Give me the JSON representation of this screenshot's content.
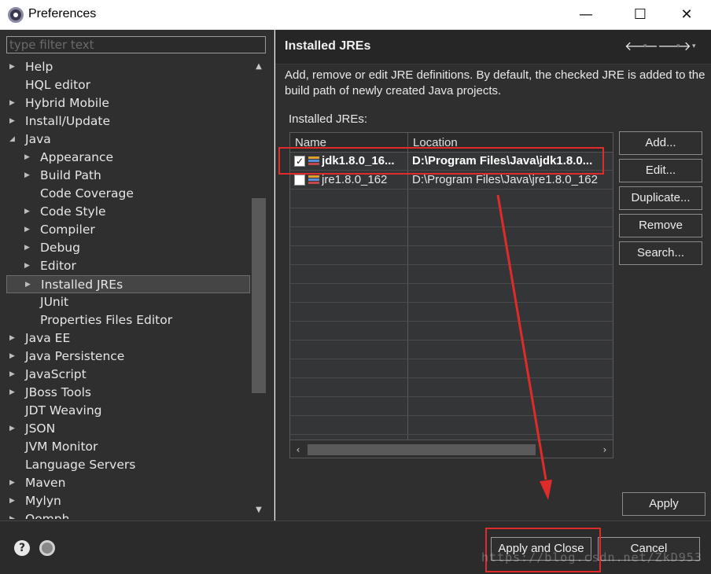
{
  "window": {
    "title": "Preferences",
    "minimize": "—",
    "maximize": "☐",
    "close": "✕"
  },
  "filter": {
    "placeholder": "type filter text"
  },
  "tree": [
    {
      "label": "Help",
      "level": 0,
      "expander": "▶"
    },
    {
      "label": "HQL editor",
      "level": 0,
      "expander": ""
    },
    {
      "label": "Hybrid Mobile",
      "level": 0,
      "expander": "▶"
    },
    {
      "label": "Install/Update",
      "level": 0,
      "expander": "▶"
    },
    {
      "label": "Java",
      "level": 0,
      "expander": "◢"
    },
    {
      "label": "Appearance",
      "level": 1,
      "expander": "▶"
    },
    {
      "label": "Build Path",
      "level": 1,
      "expander": "▶"
    },
    {
      "label": "Code Coverage",
      "level": 1,
      "expander": ""
    },
    {
      "label": "Code Style",
      "level": 1,
      "expander": "▶"
    },
    {
      "label": "Compiler",
      "level": 1,
      "expander": "▶"
    },
    {
      "label": "Debug",
      "level": 1,
      "expander": "▶"
    },
    {
      "label": "Editor",
      "level": 1,
      "expander": "▶"
    },
    {
      "label": "Installed JREs",
      "level": 1,
      "expander": "▶",
      "selected": true
    },
    {
      "label": "JUnit",
      "level": 1,
      "expander": ""
    },
    {
      "label": "Properties Files Editor",
      "level": 1,
      "expander": ""
    },
    {
      "label": "Java EE",
      "level": 0,
      "expander": "▶"
    },
    {
      "label": "Java Persistence",
      "level": 0,
      "expander": "▶"
    },
    {
      "label": "JavaScript",
      "level": 0,
      "expander": "▶"
    },
    {
      "label": "JBoss Tools",
      "level": 0,
      "expander": "▶"
    },
    {
      "label": "JDT Weaving",
      "level": 0,
      "expander": ""
    },
    {
      "label": "JSON",
      "level": 0,
      "expander": "▶"
    },
    {
      "label": "JVM Monitor",
      "level": 0,
      "expander": ""
    },
    {
      "label": "Language Servers",
      "level": 0,
      "expander": ""
    },
    {
      "label": "Maven",
      "level": 0,
      "expander": "▶"
    },
    {
      "label": "Mylyn",
      "level": 0,
      "expander": "▶"
    },
    {
      "label": "Oomph",
      "level": 0,
      "expander": "▶"
    }
  ],
  "page": {
    "title": "Installed JREs",
    "nav_back": "🡐",
    "nav_forward": "🡒",
    "nav_dropdown": "▾",
    "description": "Add, remove or edit JRE definitions. By default, the checked JRE is added to the build path of newly created Java projects.",
    "installed_label": "Installed JREs:",
    "columns": {
      "name": "Name",
      "location": "Location"
    },
    "rows": [
      {
        "name": "jdk1.8.0_16...",
        "location": "D:\\Program Files\\Java\\jdk1.8.0...",
        "checked": true,
        "bold": true
      },
      {
        "name": "jre1.8.0_162",
        "location": "D:\\Program Files\\Java\\jre1.8.0_162",
        "checked": false,
        "bold": false
      }
    ],
    "buttons": [
      "Add...",
      "Edit...",
      "Duplicate...",
      "Remove",
      "Search..."
    ],
    "apply": "Apply"
  },
  "footer": {
    "help": "?",
    "apply_close": "Apply and Close",
    "cancel": "Cancel"
  },
  "watermark": "https://blog.csdn.net/ZkD953",
  "colors": {
    "annotation": "#e02b2b",
    "background": "#2f2f2f"
  }
}
